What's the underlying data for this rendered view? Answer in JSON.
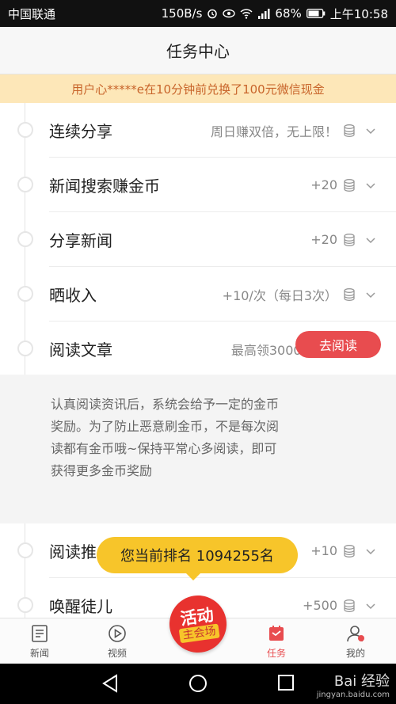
{
  "status_bar": {
    "carrier": "中国联通",
    "speed": "150B/s",
    "battery": "68%",
    "time": "上午10:58"
  },
  "header": {
    "title": "任务中心"
  },
  "notice": {
    "text": "用户心*****e在10分钟前兑换了100元微信现金"
  },
  "tasks": [
    {
      "name": "连续分享",
      "reward": "周日赚双倍，无上限！"
    },
    {
      "name": "新闻搜索赚金币",
      "reward": "+20"
    },
    {
      "name": "分享新闻",
      "reward": "+20"
    },
    {
      "name": "晒收入",
      "reward": "+10/次（每日3次）"
    },
    {
      "name": "阅读文章",
      "reward": "最高领3000+金币"
    },
    {
      "name": "阅读推",
      "reward": "+10"
    },
    {
      "name": "唤醒徒儿",
      "reward": "+500"
    }
  ],
  "expanded": {
    "description": "认真阅读资讯后，系统会给予一定的金币奖励。为了防止恶意刷金币，不是每次阅读都有金币哦~保持平常心多阅读，即可获得更多金币奖励",
    "button": "去阅读"
  },
  "rank_bubble": {
    "text": "您当前排名 1094255名"
  },
  "activity": {
    "line1": "活动",
    "line2": "主会场"
  },
  "tabbar": [
    {
      "label": "新闻",
      "icon": "news-icon"
    },
    {
      "label": "视频",
      "icon": "video-play-icon"
    },
    {
      "label": "任务",
      "icon": "task-icon"
    },
    {
      "label": "我的",
      "icon": "profile-icon"
    }
  ],
  "watermark": {
    "line1": "Bai 经验",
    "line2": "jingyan.baidu.com"
  },
  "colors": {
    "accent": "#e84c4f",
    "notice_bg": "#fde7b8",
    "notice_text": "#c8642a",
    "bubble": "#f7c52a"
  }
}
